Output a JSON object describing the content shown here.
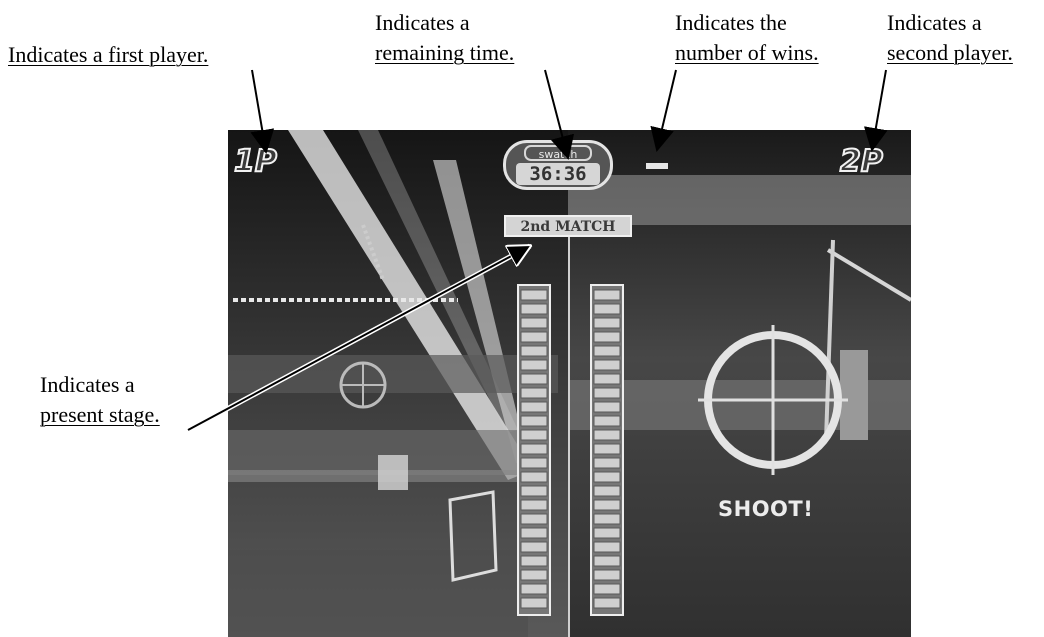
{
  "annotations": {
    "first_player": {
      "line1": "Indicates a first player.",
      "line2": ""
    },
    "remaining_time": {
      "line1": "Indicates a",
      "line2": "remaining time."
    },
    "number_of_wins": {
      "line1": "Indicates the",
      "line2": "number of wins."
    },
    "second_player": {
      "line1": "Indicates a",
      "line2": "second player."
    },
    "present_stage": {
      "line1": "Indicates a",
      "line2": "present stage."
    }
  },
  "hud": {
    "player1": "1P",
    "player2": "2P",
    "brand": "swatch",
    "time": "36:36",
    "stage": "2nd MATCH",
    "prompt": "SHOOT!"
  },
  "colors": {
    "ink": "#000000",
    "screen_bg": "#2a2a2a",
    "hud_light": "#e4e4e4"
  }
}
